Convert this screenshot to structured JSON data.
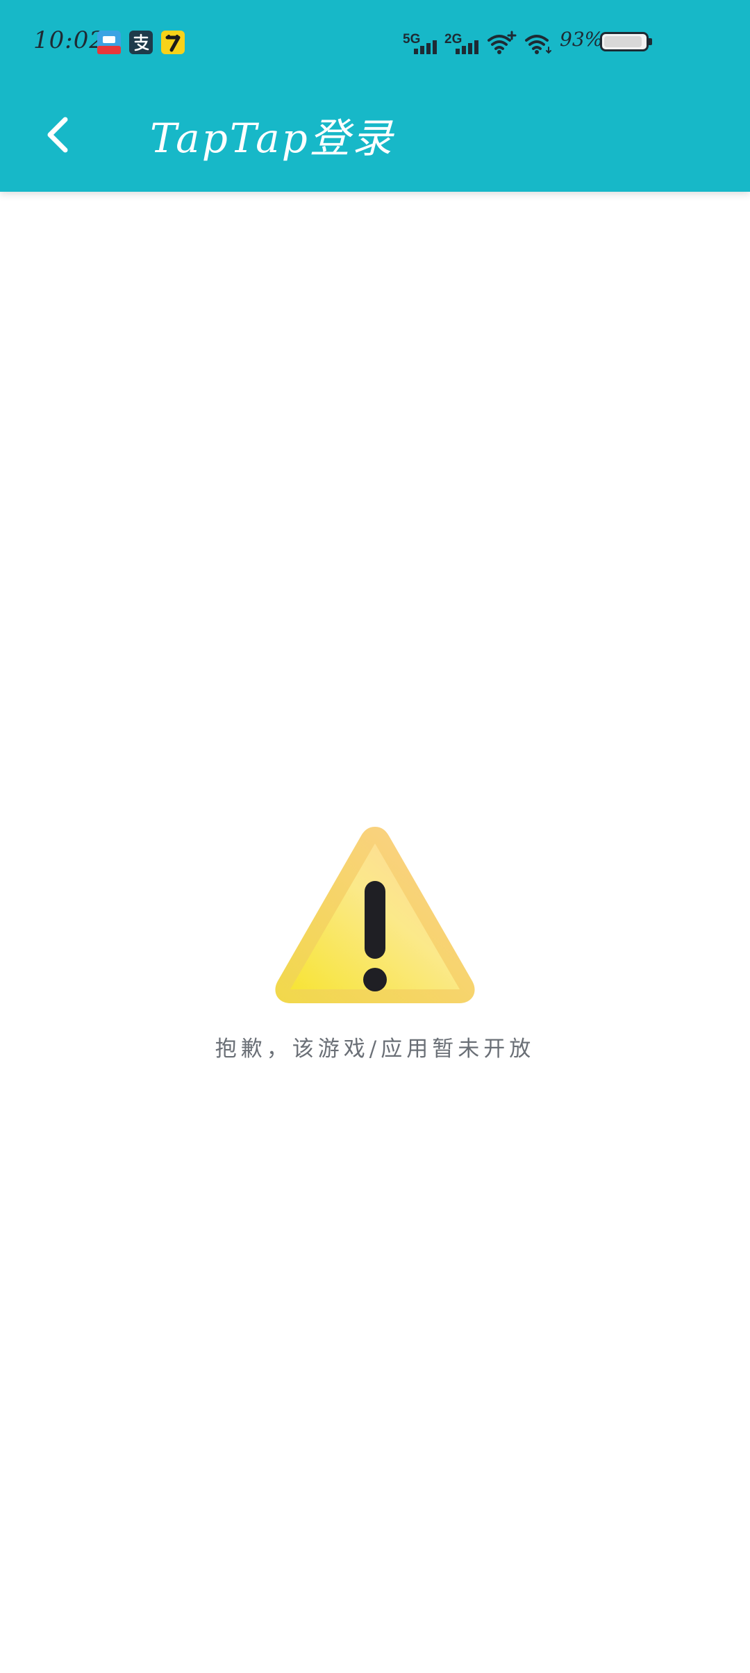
{
  "status_bar": {
    "time": "10:02",
    "network_1": "5G",
    "network_2": "2G",
    "battery_percent": "93%",
    "battery_level": 0.93,
    "icons": [
      "video-app-icon",
      "alipay-icon",
      "qimao-app-icon",
      "signal-5g-icon",
      "signal-2g-icon",
      "wifi-plus-icon",
      "wifi-icon",
      "battery-icon"
    ]
  },
  "header": {
    "title": "TapTap登录",
    "background_color": "#17b8c8"
  },
  "content": {
    "message": "抱歉，该游戏/应用暂未开放",
    "icon": "warning-icon"
  }
}
